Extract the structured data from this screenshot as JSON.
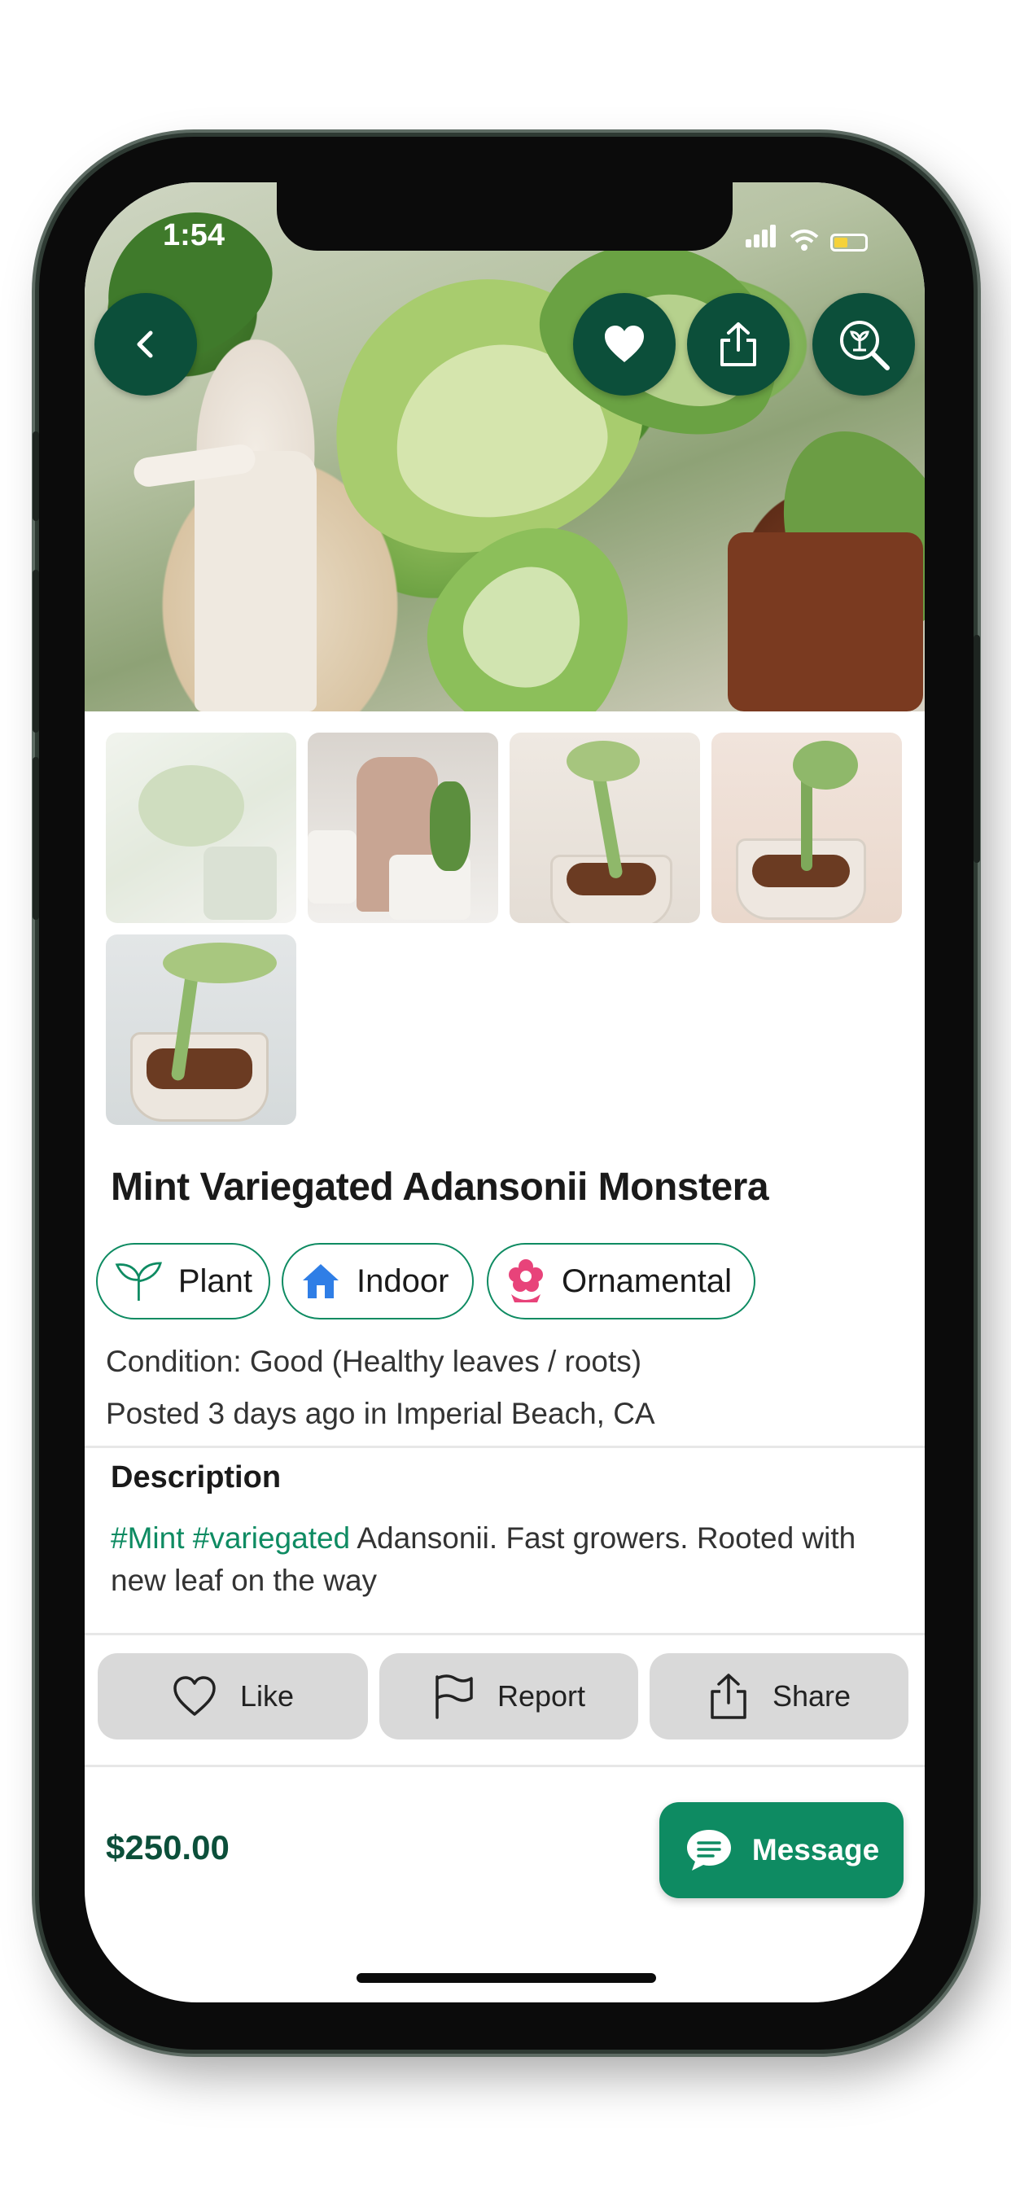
{
  "status_bar": {
    "time": "1:54"
  },
  "hero": {
    "back_icon": "chevron-left-icon",
    "favorite_icon": "heart-icon",
    "share_icon": "share-icon",
    "identify_icon": "plant-search-icon"
  },
  "listing": {
    "title": "Mint Variegated Adansonii Monstera",
    "chips": [
      {
        "label": "Plant",
        "icon": "sprout-icon",
        "color": "#0e8b62"
      },
      {
        "label": "Indoor",
        "icon": "house-icon",
        "color": "#2f7ee6"
      },
      {
        "label": "Ornamental",
        "icon": "flower-icon",
        "color": "#e8437a"
      }
    ],
    "condition": "Condition: Good (Healthy leaves / roots)",
    "posted": "Posted 3 days ago in Imperial Beach, CA"
  },
  "description": {
    "heading": "Description",
    "tag1": "#Mint",
    "tag2": "#variegated",
    "text": " Adansonii. Fast growers. Rooted with new leaf on the way"
  },
  "actions": {
    "like": "Like",
    "report": "Report",
    "share": "Share"
  },
  "footer": {
    "price": "$250.00",
    "message": "Message"
  },
  "colors": {
    "brand_dark": "#0c4f3a",
    "brand": "#0e8b62",
    "action_bg": "#d9d9d9"
  }
}
